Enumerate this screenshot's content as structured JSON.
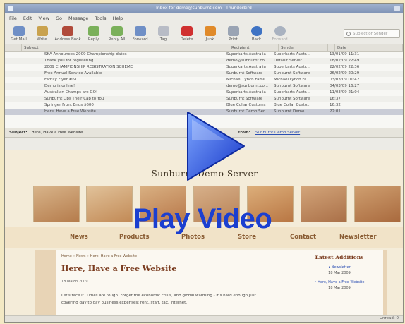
{
  "window": {
    "title": "Inbox for demo@sunburnt.com - Thunderbird"
  },
  "menu": [
    "File",
    "Edit",
    "View",
    "Go",
    "Message",
    "Tools",
    "Help"
  ],
  "toolbar": {
    "get_mail": "Get Mail",
    "write": "Write",
    "address_book": "Address Book",
    "reply": "Reply",
    "reply_all": "Reply All",
    "forward": "Forward",
    "tag": "Tag",
    "delete": "Delete",
    "junk": "Junk",
    "print": "Print",
    "back": "Back",
    "forward_nav": "Forward",
    "search_placeholder": "Subject or Sender"
  },
  "columns": {
    "subject": "Subject",
    "recipient": "Recipient",
    "sender": "Sender",
    "date": "Date"
  },
  "messages": [
    {
      "subject": "SKA Announces 2009 Championship dates",
      "recipient": "Superkarts Australia",
      "sender": "Superkarts Austr...",
      "date": "13/01/09 11:31"
    },
    {
      "subject": "Thank you for registering",
      "recipient": "demo@sunburnt.co...",
      "sender": "Default Server",
      "date": "18/02/09 22:49"
    },
    {
      "subject": "2009 CHAMPIONSHIP REGISTRATION SCHEME",
      "recipient": "Superkarts Australia",
      "sender": "Superkarts Austr...",
      "date": "22/02/09 22:36"
    },
    {
      "subject": "Free Annual Service Available",
      "recipient": "Sunburnt Software",
      "sender": "Sunburnt Software",
      "date": "26/02/09 20:29"
    },
    {
      "subject": "Family Flyer #61",
      "recipient": "Michael Lynch Famil...",
      "sender": "Michael Lynch Fa...",
      "date": "03/03/09 01:42"
    },
    {
      "subject": "Demo is online!",
      "recipient": "demo@sunburnt.co...",
      "sender": "Sunburnt Software",
      "date": "04/03/09 16:27"
    },
    {
      "subject": "Australian Champs are GO!",
      "recipient": "Superkarts Australia",
      "sender": "Superkarts Austr...",
      "date": "11/03/09 21:04"
    },
    {
      "subject": "Sunburnt Ops Their Cap to You",
      "recipient": "Sunburnt Software",
      "sender": "Sunburnt Software",
      "date": "16:37"
    },
    {
      "subject": "Springer Front Ends $600",
      "recipient": "Blue Collar Customs",
      "sender": "Blue Collar Custo...",
      "date": "16:32"
    },
    {
      "subject": "Here, Have a Free Website",
      "recipient": "Sunburnt Demo Ser...",
      "sender": "Sunburnt Demo ...",
      "date": "22:01"
    }
  ],
  "message_header": {
    "subject_label": "Subject:",
    "subject": "Here, Have a Free Website",
    "from_label": "From:",
    "from": "Sunburnt Demo Server"
  },
  "site": {
    "title": "Sunburnt Demo Server",
    "nav": [
      "News",
      "Products",
      "Photos",
      "Store",
      "Contact",
      "Newsletter"
    ],
    "breadcrumb": "Home » News » Here, Have a Free Website",
    "post_title": "Here, Have a Free Website",
    "post_date": "18 March 2009",
    "post_body": "Let's face it. Times are tough. Forget the economic crisis, and global warming - it's hard enough just covering day to day business expenses: rent, staff, tax, internet,",
    "sidebar_title": "Latest Additions",
    "sidebar_items": [
      {
        "label": "Newsletter",
        "date": "18 Mar 2009"
      },
      {
        "label": "Here, Have a Free Website",
        "date": "18 Mar 2009"
      }
    ]
  },
  "status": {
    "unread": "Unread: 0"
  },
  "overlay": {
    "play_label": "Play Video"
  },
  "colors": {
    "play_blue": "#1b3fd0",
    "accent_brown": "#7a3b1e"
  }
}
